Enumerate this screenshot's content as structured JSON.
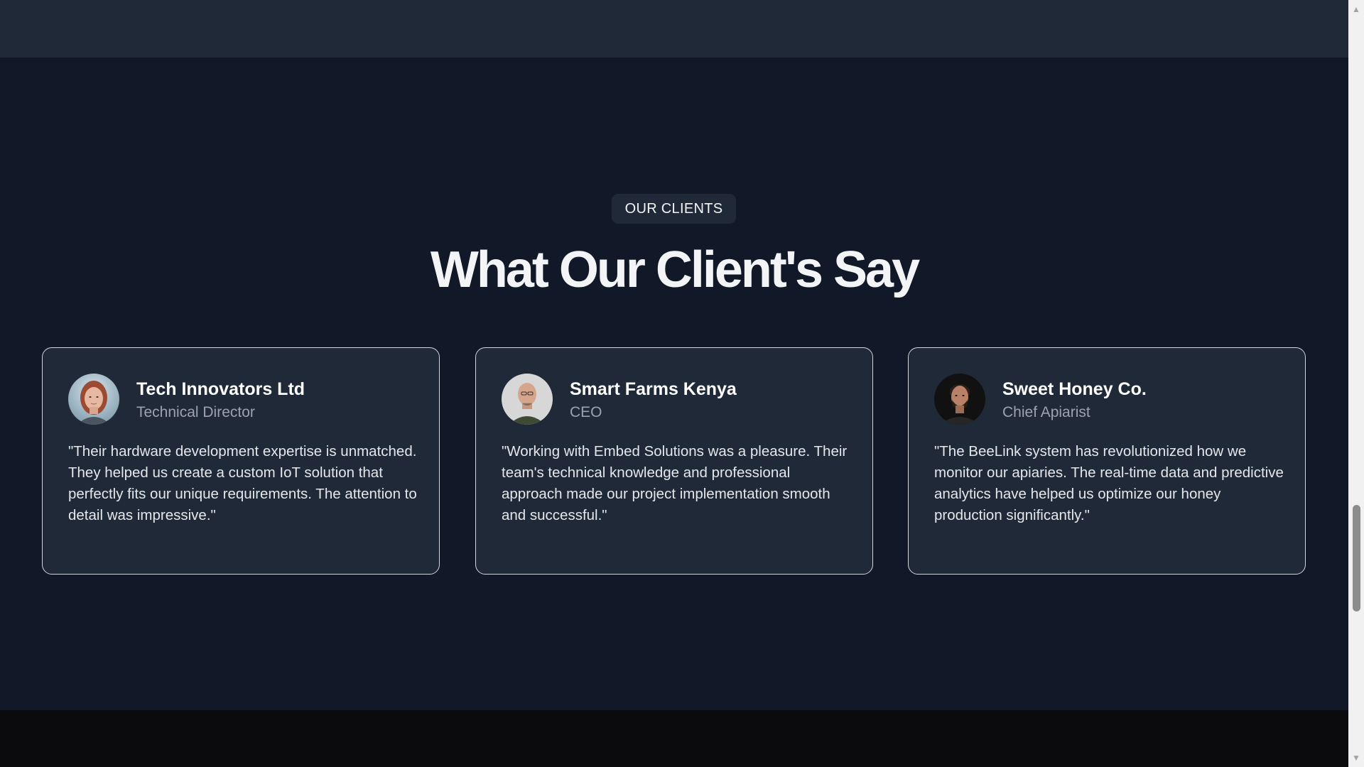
{
  "section": {
    "badge": "OUR CLIENTS",
    "heading": "What Our Client's Say"
  },
  "testimonials": [
    {
      "company": "Tech Innovators Ltd",
      "role": "Technical Director",
      "quote": "\"Their hardware development expertise is unmatched. They helped us create a custom IoT solution that perfectly fits our unique requirements. The attention to detail was impressive.\"",
      "avatar": "woman-portrait"
    },
    {
      "company": "Smart Farms Kenya",
      "role": "CEO",
      "quote": "\"Working with Embed Solutions was a pleasure. Their team's technical knowledge and professional approach made our project implementation smooth and successful.\"",
      "avatar": "bald-man-portrait"
    },
    {
      "company": "Sweet Honey Co.",
      "role": "Chief Apiarist",
      "quote": "\"The BeeLink system has revolutionized how we monitor our apiaries. The real-time data and predictive analytics have helped us optimize our honey production significantly.\"",
      "avatar": "bearded-man-portrait"
    }
  ],
  "scrollbar": {
    "up_icon": "triangle-up-icon",
    "down_icon": "triangle-down-icon"
  },
  "colors": {
    "background": "#111827",
    "card": "#1f2937",
    "card_border": "#d1d5db",
    "footer": "#0b0b0d"
  }
}
